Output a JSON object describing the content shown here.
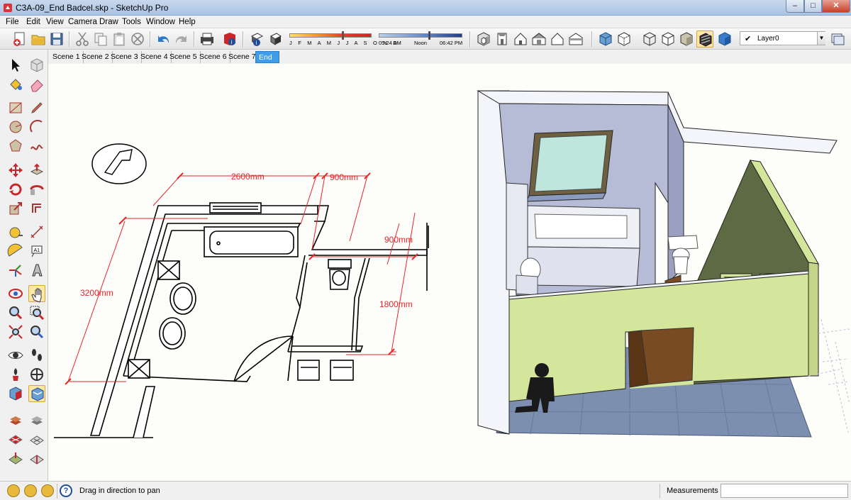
{
  "window": {
    "title": "C3A-09_End Badcel.skp - SketchUp Pro",
    "min": "–",
    "max": "□",
    "close": "✕"
  },
  "menu": [
    "File",
    "Edit",
    "View",
    "Camera",
    "Draw",
    "Tools",
    "Window",
    "Help"
  ],
  "shadow": {
    "months": "J F M A M J J A S O N D",
    "time_start": "05:24 AM",
    "time_mid": "Noon",
    "time_end": "06:42 PM"
  },
  "layer": {
    "check": "✔",
    "name": "Layer0",
    "dropdown": "▼"
  },
  "scenes": [
    "Scene 1",
    "Scene 2",
    "Scene 3",
    "Scene 4",
    "Scene 5",
    "Scene 6",
    "Scene 7",
    "End"
  ],
  "active_scene": "End",
  "dimensions": {
    "width_a": "2600mm",
    "width_b": "900mm",
    "right_a": "900mm",
    "right_b": "1800mm",
    "left": "3200mm"
  },
  "status": {
    "help": "?",
    "message": "Drag in direction to pan",
    "measurements_label": "Measurements",
    "measurements_value": ""
  },
  "colors": {
    "dimension": "#e8252b",
    "active_tab": "#3f9cea",
    "wall_green": "#d4e59c",
    "wall_dark": "#5e6a44",
    "floor": "#7d8fb0",
    "wall_blue": "#b6bcd6"
  }
}
